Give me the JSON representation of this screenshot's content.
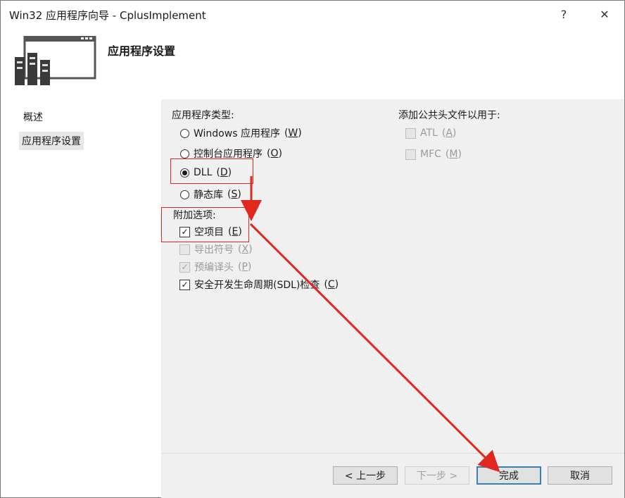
{
  "window": {
    "title": "Win32 应用程序向导 - CplusImplement",
    "help": "?",
    "close": "✕"
  },
  "header": {
    "title": "应用程序设置"
  },
  "sidebar": {
    "items": [
      {
        "label": "概述"
      },
      {
        "label": "应用程序设置"
      }
    ]
  },
  "app_type": {
    "label": "应用程序类型:",
    "options": [
      {
        "text": "Windows 应用程序",
        "accel": "W",
        "checked": false
      },
      {
        "text": "控制台应用程序",
        "accel": "O",
        "checked": false
      },
      {
        "text": "DLL",
        "accel": "D",
        "checked": true
      },
      {
        "text": "静态库",
        "accel": "S",
        "checked": false
      }
    ]
  },
  "extra": {
    "label": "附加选项:",
    "options": [
      {
        "text": "空项目",
        "accel": "E",
        "checked": true,
        "enabled": true
      },
      {
        "text": "导出符号",
        "accel": "X",
        "checked": false,
        "enabled": false
      },
      {
        "text": "预编译头",
        "accel": "P",
        "checked": true,
        "enabled": false
      },
      {
        "text": "安全开发生命周期(SDL)检查",
        "accel": "C",
        "checked": true,
        "enabled": true
      }
    ]
  },
  "common_headers": {
    "label": "添加公共头文件以用于:",
    "options": [
      {
        "text": "ATL",
        "accel": "A",
        "checked": false,
        "enabled": false
      },
      {
        "text": "MFC",
        "accel": "M",
        "checked": false,
        "enabled": false
      }
    ]
  },
  "footer": {
    "prev": "< 上一步",
    "next": "下一步 >",
    "finish": "完成",
    "cancel": "取消"
  },
  "colors": {
    "annotation": "#e0281e",
    "focus": "#3c7fb1"
  }
}
